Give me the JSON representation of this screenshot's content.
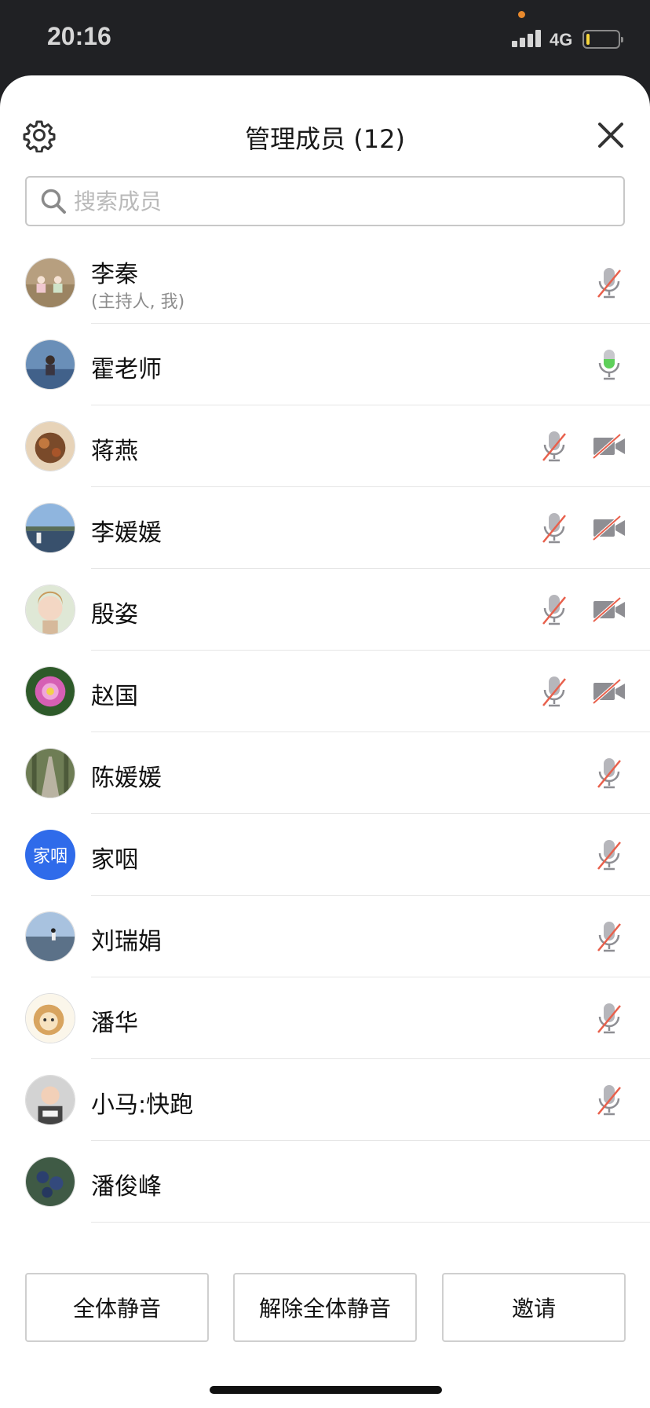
{
  "status_bar": {
    "time": "20:16",
    "network": "4G",
    "battery_level": 0.1,
    "battery_color": "#f5d53b",
    "dot_color": "#e8892c"
  },
  "header": {
    "title": "管理成员 (12)",
    "settings_icon": "gear-icon",
    "close_icon": "close-icon"
  },
  "search": {
    "placeholder": "搜索成员",
    "value": ""
  },
  "members": [
    {
      "name": "李秦",
      "subtitle": "(主持人, 我)",
      "mic": "muted",
      "camera": "none"
    },
    {
      "name": "霍老师",
      "subtitle": "",
      "mic": "active",
      "camera": "none"
    },
    {
      "name": "蒋燕",
      "subtitle": "",
      "mic": "muted",
      "camera": "off"
    },
    {
      "name": "李媛媛",
      "subtitle": "",
      "mic": "muted",
      "camera": "off"
    },
    {
      "name": "殷姿",
      "subtitle": "",
      "mic": "muted",
      "camera": "off"
    },
    {
      "name": "赵国",
      "subtitle": "",
      "mic": "muted",
      "camera": "off"
    },
    {
      "name": "陈媛媛",
      "subtitle": "",
      "mic": "muted",
      "camera": "none"
    },
    {
      "name": "家咽",
      "subtitle": "",
      "avatar_text": "家咽",
      "mic": "muted",
      "camera": "none"
    },
    {
      "name": "刘瑞娟",
      "subtitle": "",
      "mic": "muted",
      "camera": "none"
    },
    {
      "name": "潘华",
      "subtitle": "",
      "mic": "muted",
      "camera": "none"
    },
    {
      "name": "小马:快跑",
      "subtitle": "",
      "mic": "muted",
      "camera": "none"
    },
    {
      "name": "潘俊峰",
      "subtitle": "",
      "mic": "none",
      "camera": "none"
    }
  ],
  "footer": {
    "mute_all": "全体静音",
    "unmute_all": "解除全体静音",
    "invite": "邀请"
  },
  "colors": {
    "mute_slash": "#e8604c",
    "active_mic": "#5ed05a",
    "icon_gray": "#8e8e93",
    "text_avatar_bg": "#2f6bea"
  }
}
